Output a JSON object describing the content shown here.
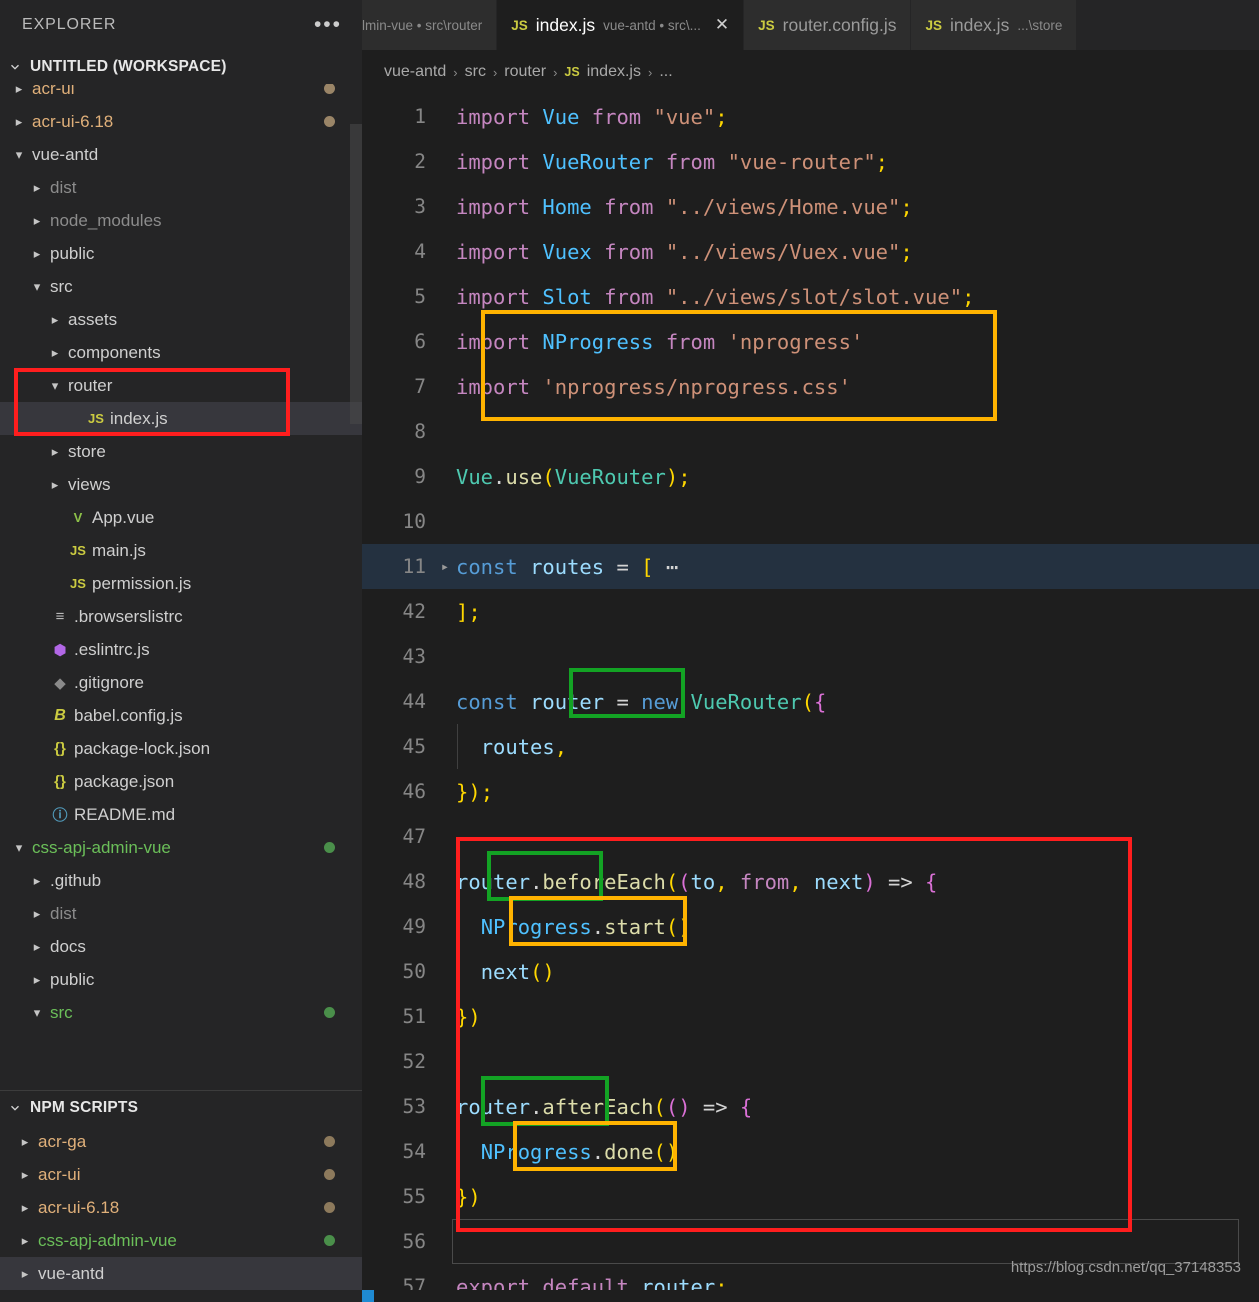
{
  "sidebar": {
    "title": "EXPLORER",
    "more_actions": "•••",
    "workspace_label": "UNTITLED (WORKSPACE)",
    "tree": [
      {
        "label": "acr-ui",
        "indent": 1,
        "type": "folder",
        "state": "collapsed",
        "dim": true,
        "color": "orange",
        "dot": "#9a8567",
        "clipped": true
      },
      {
        "label": "acr-ui-6.18",
        "indent": 1,
        "type": "folder",
        "state": "collapsed",
        "dim": false,
        "color": "orange",
        "dot": "#9a8567"
      },
      {
        "label": "vue-antd",
        "indent": 1,
        "type": "folder",
        "state": "expanded",
        "dim": false,
        "color": "plain"
      },
      {
        "label": "dist",
        "indent": 2,
        "type": "folder",
        "state": "collapsed",
        "dim": true,
        "color": "plain"
      },
      {
        "label": "node_modules",
        "indent": 2,
        "type": "folder",
        "state": "collapsed",
        "dim": true,
        "color": "plain"
      },
      {
        "label": "public",
        "indent": 2,
        "type": "folder",
        "state": "collapsed",
        "dim": false,
        "color": "plain"
      },
      {
        "label": "src",
        "indent": 2,
        "type": "folder",
        "state": "expanded",
        "dim": false,
        "color": "plain"
      },
      {
        "label": "assets",
        "indent": 3,
        "type": "folder",
        "state": "collapsed",
        "dim": false,
        "color": "plain"
      },
      {
        "label": "components",
        "indent": 3,
        "type": "folder",
        "state": "collapsed",
        "dim": false,
        "color": "plain"
      },
      {
        "label": "router",
        "indent": 3,
        "type": "folder",
        "state": "expanded",
        "dim": false,
        "color": "plain"
      },
      {
        "label": "index.js",
        "indent": 4,
        "type": "js",
        "state": "file",
        "dim": false,
        "color": "plain",
        "selected": true
      },
      {
        "label": "store",
        "indent": 3,
        "type": "folder",
        "state": "collapsed",
        "dim": false,
        "color": "plain"
      },
      {
        "label": "views",
        "indent": 3,
        "type": "folder",
        "state": "collapsed",
        "dim": false,
        "color": "plain"
      },
      {
        "label": "App.vue",
        "indent": 3,
        "type": "vue",
        "state": "file",
        "dim": false,
        "color": "plain"
      },
      {
        "label": "main.js",
        "indent": 3,
        "type": "js",
        "state": "file",
        "dim": false,
        "color": "plain"
      },
      {
        "label": "permission.js",
        "indent": 3,
        "type": "js",
        "state": "file",
        "dim": false,
        "color": "plain"
      },
      {
        "label": ".browserslistrc",
        "indent": 2,
        "type": "list",
        "state": "file",
        "dim": false,
        "color": "plain"
      },
      {
        "label": ".eslintrc.js",
        "indent": 2,
        "type": "eslint",
        "state": "file",
        "dim": false,
        "color": "plain"
      },
      {
        "label": ".gitignore",
        "indent": 2,
        "type": "git",
        "state": "file",
        "dim": false,
        "color": "plain"
      },
      {
        "label": "babel.config.js",
        "indent": 2,
        "type": "babel",
        "state": "file",
        "dim": false,
        "color": "plain"
      },
      {
        "label": "package-lock.json",
        "indent": 2,
        "type": "json",
        "state": "file",
        "dim": false,
        "color": "plain"
      },
      {
        "label": "package.json",
        "indent": 2,
        "type": "json",
        "state": "file",
        "dim": false,
        "color": "plain"
      },
      {
        "label": "README.md",
        "indent": 2,
        "type": "info",
        "state": "file",
        "dim": false,
        "color": "plain"
      },
      {
        "label": "css-apj-admin-vue",
        "indent": 1,
        "type": "folder",
        "state": "expanded",
        "dim": false,
        "color": "green",
        "dot": "#4a8f4a"
      },
      {
        "label": ".github",
        "indent": 2,
        "type": "folder",
        "state": "collapsed",
        "dim": false,
        "color": "plain"
      },
      {
        "label": "dist",
        "indent": 2,
        "type": "folder",
        "state": "collapsed",
        "dim": true,
        "color": "plain"
      },
      {
        "label": "docs",
        "indent": 2,
        "type": "folder",
        "state": "collapsed",
        "dim": false,
        "color": "plain"
      },
      {
        "label": "public",
        "indent": 2,
        "type": "folder",
        "state": "collapsed",
        "dim": false,
        "color": "plain"
      },
      {
        "label": "src",
        "indent": 2,
        "type": "folder",
        "state": "expanded",
        "dim": false,
        "color": "green",
        "dot": "#4a8f4a",
        "clipped_bottom": true
      }
    ],
    "npm_scripts": {
      "header": "NPM SCRIPTS",
      "items": [
        {
          "label": "acr-ga",
          "color": "orange",
          "dot": "#8d7a5c"
        },
        {
          "label": "acr-ui",
          "color": "orange",
          "dot": "#8d7a5c"
        },
        {
          "label": "acr-ui-6.18",
          "color": "orange",
          "dot": "#8d7a5c"
        },
        {
          "label": "css-apj-admin-vue",
          "color": "green",
          "dot": "#4a8f4a"
        },
        {
          "label": "vue-antd",
          "color": "plain",
          "selected": true
        }
      ]
    }
  },
  "tabs": [
    {
      "name": "",
      "desc": "lmin-vue • src\\router",
      "icon": "",
      "active": false,
      "clipped": true
    },
    {
      "name": "index.js",
      "desc": "vue-antd • src\\...",
      "icon": "JS",
      "active": true,
      "close": "✕"
    },
    {
      "name": "router.config.js",
      "desc": "",
      "icon": "JS",
      "active": false
    },
    {
      "name": "index.js",
      "desc": "...\\store",
      "icon": "JS",
      "active": false
    }
  ],
  "breadcrumb": {
    "items": [
      "vue-antd",
      "src",
      "router",
      "index.js",
      "..."
    ],
    "file_icon": "JS",
    "separator": "›"
  },
  "code": {
    "lines": [
      {
        "n": "1",
        "text": "import Vue from \"vue\";"
      },
      {
        "n": "2",
        "text": "import VueRouter from \"vue-router\";"
      },
      {
        "n": "3",
        "text": "import Home from \"../views/Home.vue\";"
      },
      {
        "n": "4",
        "text": "import Vuex from \"../views/Vuex.vue\";"
      },
      {
        "n": "5",
        "text": "import Slot from \"../views/slot/slot.vue\";"
      },
      {
        "n": "6",
        "text": "import NProgress from 'nprogress'"
      },
      {
        "n": "7",
        "text": "import 'nprogress/nprogress.css'"
      },
      {
        "n": "8",
        "text": ""
      },
      {
        "n": "9",
        "text": "Vue.use(VueRouter);"
      },
      {
        "n": "10",
        "text": ""
      },
      {
        "n": "11",
        "text": "const routes = [ ⋯",
        "folded": true
      },
      {
        "n": "42",
        "text": "];"
      },
      {
        "n": "43",
        "text": ""
      },
      {
        "n": "44",
        "text": "const router = new VueRouter({"
      },
      {
        "n": "45",
        "text": "  routes,"
      },
      {
        "n": "46",
        "text": "});"
      },
      {
        "n": "47",
        "text": ""
      },
      {
        "n": "48",
        "text": "router.beforeEach((to, from, next) => {"
      },
      {
        "n": "49",
        "text": "  NProgress.start()"
      },
      {
        "n": "50",
        "text": "  next()"
      },
      {
        "n": "51",
        "text": "})"
      },
      {
        "n": "52",
        "text": ""
      },
      {
        "n": "53",
        "text": "router.afterEach(() => {"
      },
      {
        "n": "54",
        "text": "  NProgress.done()"
      },
      {
        "n": "55",
        "text": "})"
      },
      {
        "n": "56",
        "text": "",
        "cursor": true
      },
      {
        "n": "57",
        "text": "export default router;"
      }
    ]
  },
  "annotations": {
    "imports_box_color": "#ffb300",
    "router_box_color": "#13a324",
    "block_box_color": "#ff1e1e",
    "nprogress_box_color": "#ffb300",
    "file_box_color": "#ff1e1e"
  },
  "watermark": "https://blog.csdn.net/qq_37148353",
  "status_bar_color": "#1f8ad2"
}
